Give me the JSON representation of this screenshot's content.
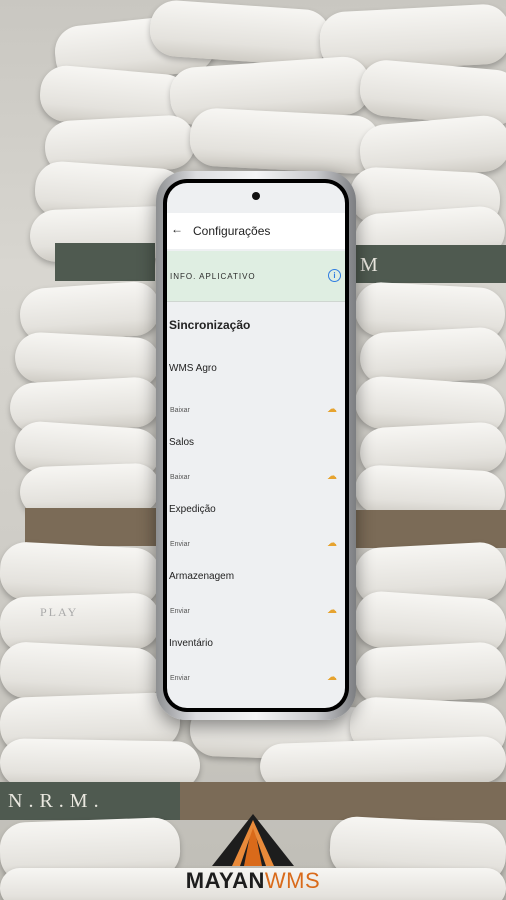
{
  "app": {
    "title": "Configurações",
    "back_icon": "arrow-back-icon"
  },
  "info_banner": {
    "label": "INFO. APLICATIVO",
    "icon": "info-icon"
  },
  "sync": {
    "section_title": "Sincronização",
    "items": [
      {
        "name": "WMS Agro",
        "action": "Baixar",
        "icon": "cloud-download-icon"
      },
      {
        "name": "Salos",
        "action": "Baixar",
        "icon": "cloud-download-icon"
      },
      {
        "name": "Expedição",
        "action": "Enviar",
        "icon": "cloud-upload-icon"
      },
      {
        "name": "Armazenagem",
        "action": "Enviar",
        "icon": "cloud-upload-icon"
      },
      {
        "name": "Inventário",
        "action": "Enviar",
        "icon": "cloud-upload-icon"
      }
    ]
  },
  "background": {
    "pallet_labels": [
      "M",
      "N.R.M.",
      "PLAY"
    ]
  },
  "brand": {
    "part1": "MAYAN",
    "part2": "WMS",
    "accent": "#d96a1a"
  }
}
